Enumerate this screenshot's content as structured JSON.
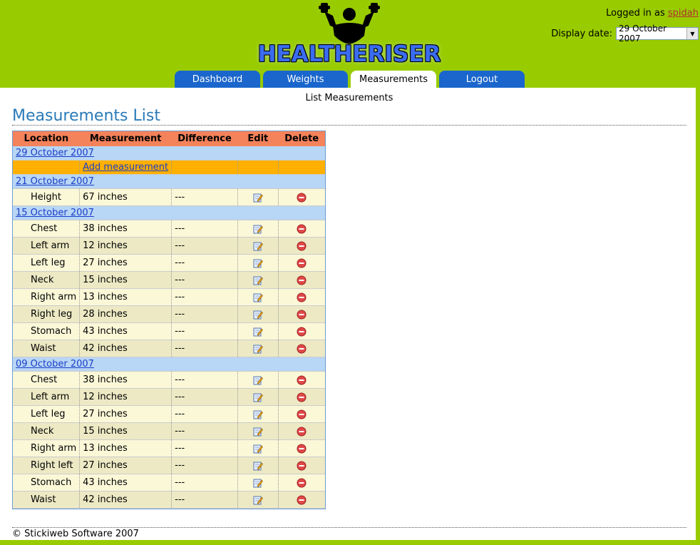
{
  "brand": {
    "title": "HEALTHERISER"
  },
  "login": {
    "prefix": "Logged in as",
    "user": "spidah"
  },
  "display_date": {
    "label": "Display date:",
    "value": "29 October 2007"
  },
  "tabs": [
    {
      "label": "Dashboard",
      "active": false
    },
    {
      "label": "Weights",
      "active": false
    },
    {
      "label": "Measurements",
      "active": true
    },
    {
      "label": "Logout",
      "active": false
    }
  ],
  "subnav": {
    "label": "List Measurements"
  },
  "page": {
    "title": "Measurements List"
  },
  "table": {
    "headers": [
      "Location",
      "Measurement",
      "Difference",
      "Edit",
      "Delete"
    ],
    "groups": [
      {
        "date": "29 October 2007",
        "add_label": "Add measurement",
        "rows": []
      },
      {
        "date": "21 October 2007",
        "rows": [
          {
            "location": "Height",
            "measurement": "67 inches",
            "difference": "---"
          }
        ]
      },
      {
        "date": "15 October 2007",
        "rows": [
          {
            "location": "Chest",
            "measurement": "38 inches",
            "difference": "---"
          },
          {
            "location": "Left arm",
            "measurement": "12 inches",
            "difference": "---"
          },
          {
            "location": "Left leg",
            "measurement": "27 inches",
            "difference": "---"
          },
          {
            "location": "Neck",
            "measurement": "15 inches",
            "difference": "---"
          },
          {
            "location": "Right arm",
            "measurement": "13 inches",
            "difference": "---"
          },
          {
            "location": "Right leg",
            "measurement": "28 inches",
            "difference": "---"
          },
          {
            "location": "Stomach",
            "measurement": "43 inches",
            "difference": "---"
          },
          {
            "location": "Waist",
            "measurement": "42 inches",
            "difference": "---"
          }
        ]
      },
      {
        "date": "09 October 2007",
        "rows": [
          {
            "location": "Chest",
            "measurement": "38 inches",
            "difference": "---"
          },
          {
            "location": "Left arm",
            "measurement": "12 inches",
            "difference": "---"
          },
          {
            "location": "Left leg",
            "measurement": "27 inches",
            "difference": "---"
          },
          {
            "location": "Neck",
            "measurement": "15 inches",
            "difference": "---"
          },
          {
            "location": "Right arm",
            "measurement": "13 inches",
            "difference": "---"
          },
          {
            "location": "Right left",
            "measurement": "27 inches",
            "difference": "---"
          },
          {
            "location": "Stomach",
            "measurement": "43 inches",
            "difference": "---"
          },
          {
            "location": "Waist",
            "measurement": "42 inches",
            "difference": "---"
          }
        ]
      }
    ]
  },
  "footer": {
    "text": "© Stickiweb Software 2007"
  },
  "colors": {
    "page_bg": "#99cc00",
    "tab_bg": "#1a66cc",
    "header_row": "#f4825a",
    "date_row": "#b8d6f5",
    "add_row": "#ffb000",
    "row_odd": "#fbf8d8",
    "row_even": "#ece9c4",
    "title": "#2a7ab8"
  },
  "icons": {
    "edit": "edit-pencil-icon",
    "delete": "delete-minus-icon",
    "logo": "muscleman-logo-icon"
  }
}
